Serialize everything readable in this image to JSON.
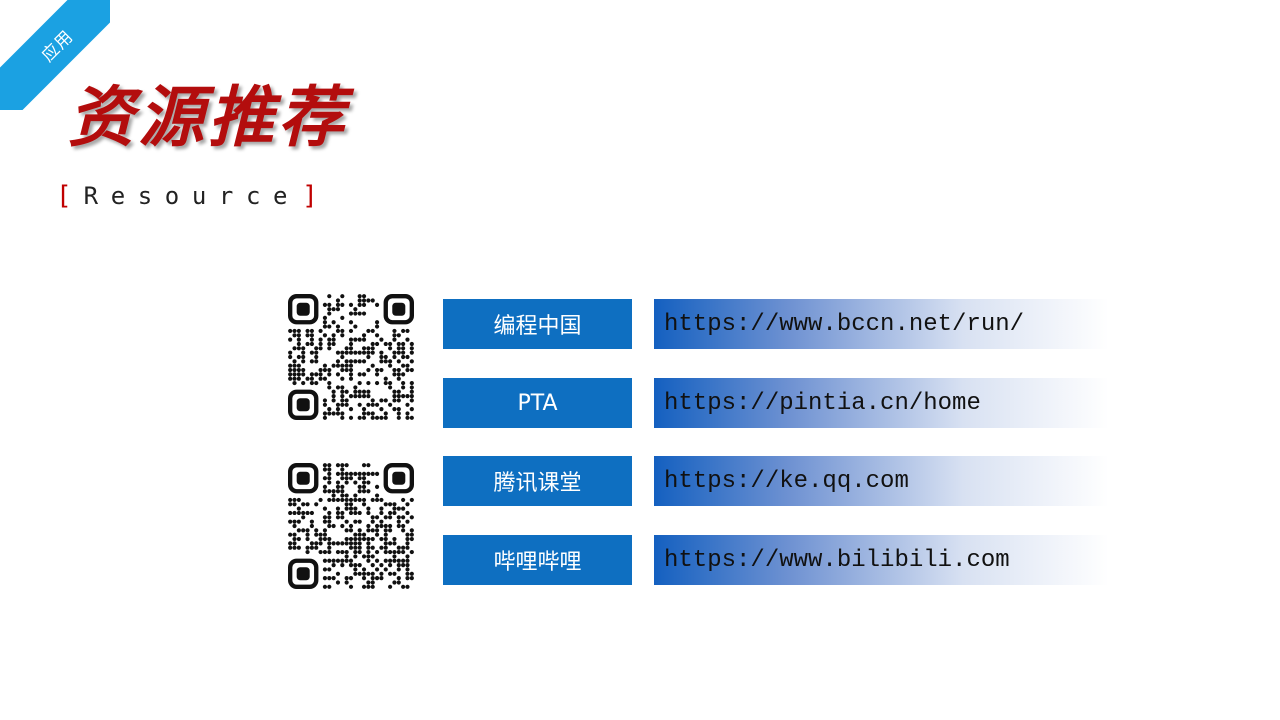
{
  "corner_tag": "应用",
  "title": "资源推荐",
  "subtitle": {
    "open_bracket": "[",
    "word": "Resource",
    "close_bracket": "]"
  },
  "resources": [
    {
      "label": "编程中国",
      "url": "https://www.bccn.net/run/"
    },
    {
      "label": "PTA",
      "url": "https://pintia.cn/home"
    },
    {
      "label": "腾讯课堂",
      "url": "https://ke.qq.com"
    },
    {
      "label": "哔哩哔哩",
      "url": "https://www.bilibili.com"
    }
  ],
  "colors": {
    "corner": "#1ba1e2",
    "title": "#b30d0d",
    "bracket": "#c00000",
    "label_bg": "#0e6fc1",
    "url_gradient_start": "#1460c0"
  },
  "icons": [
    "qr-code-icon",
    "qr-code-icon"
  ]
}
